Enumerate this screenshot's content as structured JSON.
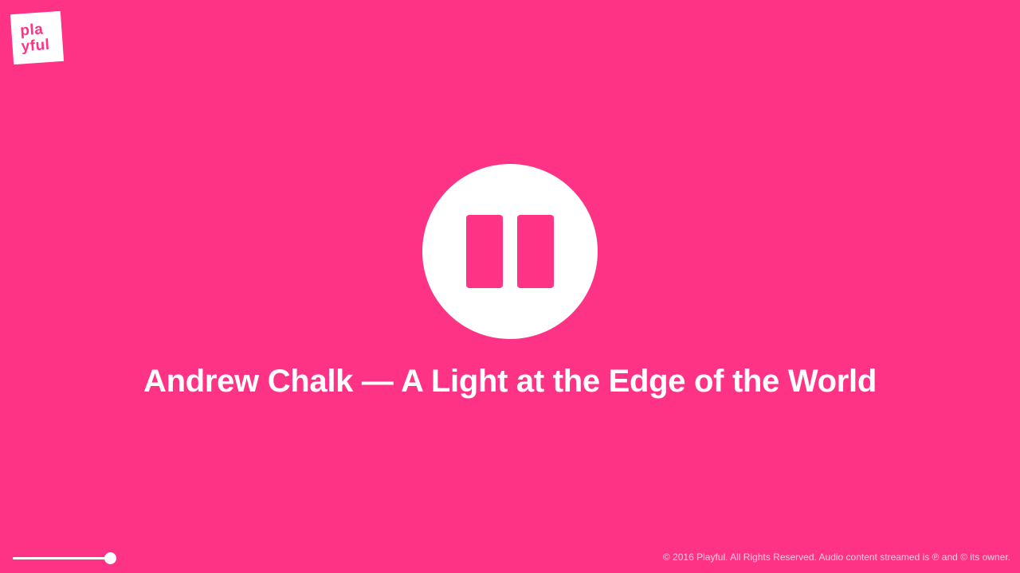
{
  "brand": {
    "logo_line1": "pla",
    "logo_line2": "yful"
  },
  "player": {
    "state_icon": "pause-icon",
    "track_title": "Andrew Chalk — A Light at the Edge of the World",
    "volume_level": 0.9
  },
  "footer": {
    "copyright": "© 2016 Playful. All Rights Reserved. Audio content streamed is ℗ and © its owner."
  },
  "colors": {
    "background": "#ff3385",
    "foreground": "#ffffff"
  }
}
